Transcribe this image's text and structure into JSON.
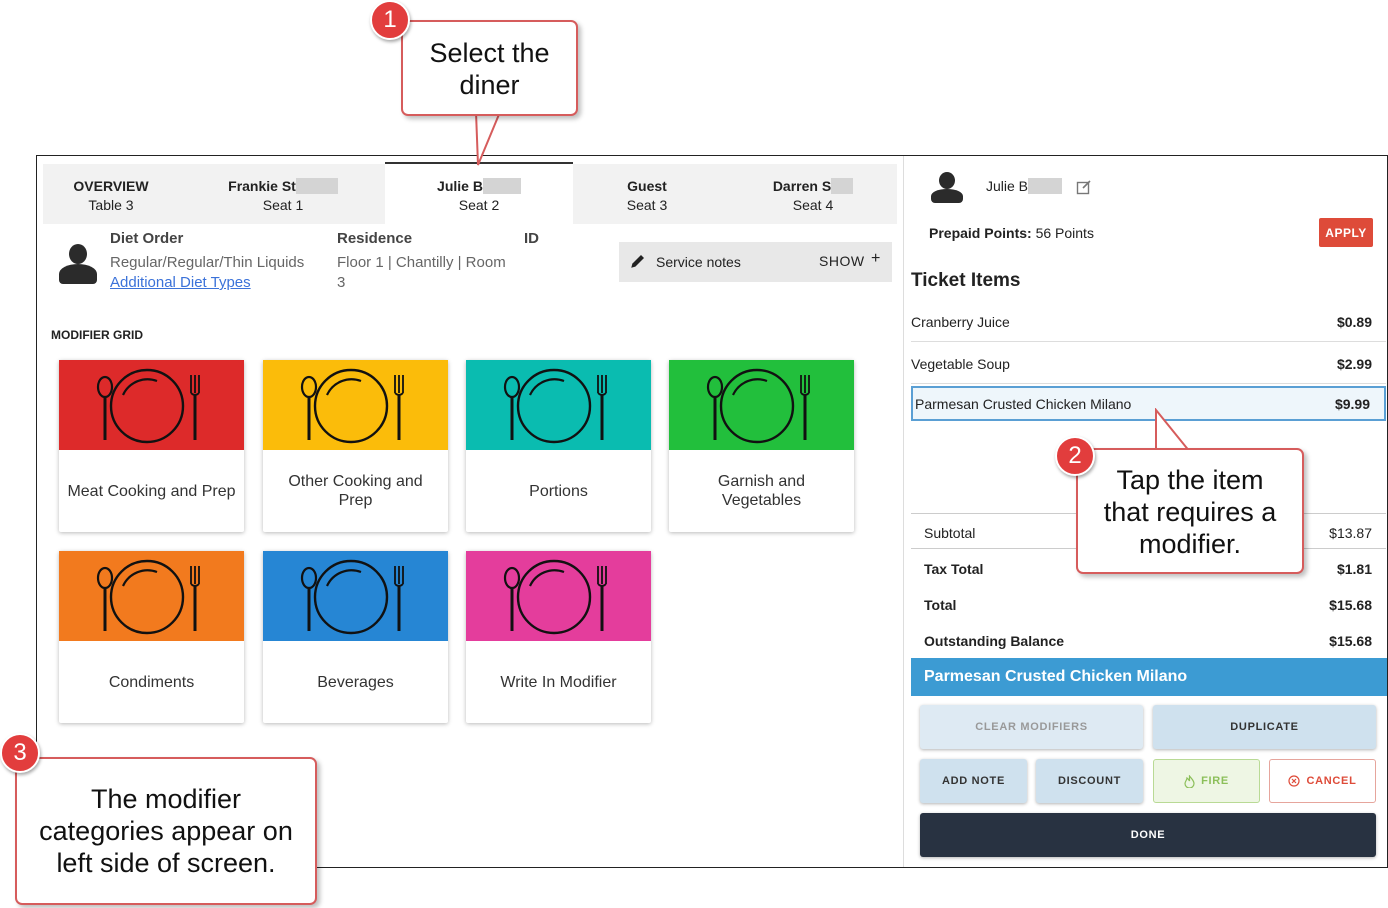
{
  "colors": {
    "meat": "#dd2a2a",
    "other": "#fbbc0a",
    "portions": "#0abcb0",
    "garnish": "#22bf3c",
    "condiments": "#f27a1e",
    "beverages": "#2686d4",
    "writein": "#e43d9c",
    "accent": "#3c9bd3",
    "callout_border": "#d65c5c",
    "apply": "#de4b39"
  },
  "tabs": [
    {
      "name": "OVERVIEW",
      "sub": "Table 3"
    },
    {
      "name": "Frankie St",
      "sub": "Seat 1"
    },
    {
      "name": "Julie B",
      "sub": "Seat 2"
    },
    {
      "name": "Guest",
      "sub": "Seat 3"
    },
    {
      "name": "Darren S",
      "sub": "Seat 4"
    }
  ],
  "diner": {
    "diet_label": "Diet Order",
    "diet_value": "Regular/Regular/Thin Liquids",
    "diet_link": "Additional Diet Types",
    "residence_label": "Residence",
    "residence_line1": "Floor 1 | Chantilly | Room",
    "residence_line2": "3",
    "id_label": "ID"
  },
  "notes": {
    "label": "Service notes",
    "action": "SHOW",
    "plus": "+",
    "icon": "pencil-icon"
  },
  "modifier_grid": {
    "title": "MODIFIER GRID",
    "icon": "plate-fork-spoon-icon",
    "items": [
      {
        "label": "Meat Cooking and Prep"
      },
      {
        "label": "Other Cooking and Prep"
      },
      {
        "label": "Portions"
      },
      {
        "label": "Garnish and Vegetables"
      },
      {
        "label": "Condiments"
      },
      {
        "label": "Beverages"
      },
      {
        "label": "Write In Modifier"
      }
    ]
  },
  "ticket": {
    "diner_name": "Julie B",
    "points_label": "Prepaid Points:",
    "points_value": "56 Points",
    "apply": "APPLY",
    "title": "Ticket Items",
    "items": [
      {
        "name": "Cranberry Juice",
        "price": "$0.89"
      },
      {
        "name": "Vegetable Soup",
        "price": "$2.99"
      },
      {
        "name": "Parmesan Crusted Chicken Milano",
        "price": "$9.99"
      }
    ],
    "subtotal_label": "Subtotal",
    "subtotal": "$13.87",
    "tax_label": "Tax Total",
    "tax": "$1.81",
    "total_label": "Total",
    "total": "$15.68",
    "balance_label": "Outstanding Balance",
    "balance": "$15.68",
    "selected_item": "Parmesan Crusted Chicken Milano"
  },
  "actions": {
    "clear": "CLEAR MODIFIERS",
    "duplicate": "DUPLICATE",
    "add_note": "ADD NOTE",
    "discount": "DISCOUNT",
    "fire": "FIRE",
    "cancel": "CANCEL",
    "done": "DONE"
  },
  "callouts": [
    {
      "num": "1",
      "line1": "Select the",
      "line2": "diner"
    },
    {
      "num": "2",
      "line1": "Tap the item",
      "line2": "that requires a",
      "line3": "modifier."
    },
    {
      "num": "3",
      "line1": "The modifier",
      "line2": "categories appear on",
      "line3": "left side of screen."
    }
  ]
}
